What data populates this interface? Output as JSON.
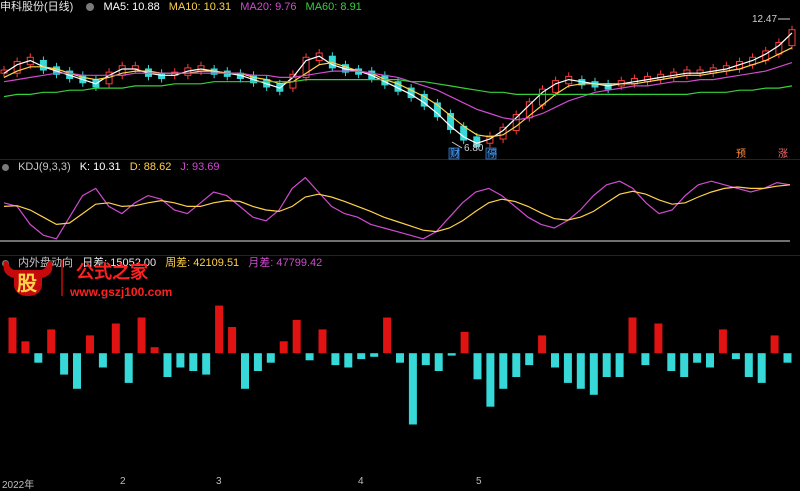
{
  "main": {
    "title": "申科股份(日线)",
    "ma": [
      {
        "label": "MA5: 10.88",
        "color": "#ffffff"
      },
      {
        "label": "MA10: 10.31",
        "color": "#ffd24a"
      },
      {
        "label": "MA20: 9.76",
        "color": "#d04bd0"
      },
      {
        "label": "MA60: 8.91",
        "color": "#35d13a"
      }
    ],
    "high_label": "12.47",
    "low_label": "6.80",
    "event_labels": [
      {
        "text": "财",
        "color": "#4aa3ff"
      },
      {
        "text": "停",
        "color": "#4aa3ff"
      },
      {
        "text": "预",
        "color": "#ff8c3a"
      },
      {
        "text": "涨",
        "color": "#ff6b6b"
      }
    ]
  },
  "kdj": {
    "title": "KDJ(9,3,3)",
    "k_label": "K: 10.31",
    "d_label": "D: 88.62",
    "j_label": "J: 93.69"
  },
  "flow": {
    "title": "内外盘动向",
    "day_label": "日差: 15052.00",
    "week_label": "周差: 42109.51",
    "month_label": "月差: 47799.42"
  },
  "axis": {
    "labels": [
      "2022年",
      "2",
      "3",
      "4",
      "5"
    ]
  },
  "watermark": {
    "logo_char": "股",
    "text": "公式之家",
    "url": "www.gszj100.com"
  },
  "chart_data": [
    {
      "type": "line",
      "name": "price",
      "series": [
        {
          "name": "MA5",
          "values": [
            10.4,
            10.8,
            11.0,
            10.7,
            10.5,
            10.3,
            10.1,
            9.9,
            10.3,
            10.6,
            10.6,
            10.4,
            10.3,
            10.3,
            10.5,
            10.6,
            10.5,
            10.4,
            10.3,
            10.1,
            9.9,
            9.7,
            10.2,
            11.0,
            11.2,
            10.8,
            10.6,
            10.5,
            10.3,
            10.0,
            9.7,
            9.4,
            9.0,
            8.5,
            7.9,
            7.4,
            7.1,
            7.3,
            7.7,
            8.3,
            8.9,
            9.5,
            9.9,
            10.1,
            10.0,
            9.9,
            9.8,
            9.9,
            10.0,
            10.1,
            10.2,
            10.3,
            10.4,
            10.4,
            10.5,
            10.6,
            10.8,
            11.0,
            11.3,
            11.7,
            12.3
          ]
        },
        {
          "name": "MA10",
          "values": [
            10.2,
            10.5,
            10.7,
            10.7,
            10.6,
            10.4,
            10.2,
            10.1,
            10.2,
            10.4,
            10.5,
            10.5,
            10.4,
            10.4,
            10.4,
            10.5,
            10.5,
            10.4,
            10.4,
            10.2,
            10.1,
            9.9,
            10.0,
            10.4,
            10.8,
            10.9,
            10.7,
            10.5,
            10.4,
            10.1,
            9.9,
            9.6,
            9.3,
            8.9,
            8.4,
            7.9,
            7.5,
            7.4,
            7.5,
            7.9,
            8.4,
            8.9,
            9.4,
            9.8,
            9.9,
            9.9,
            9.9,
            9.9,
            9.9,
            10.0,
            10.1,
            10.2,
            10.3,
            10.3,
            10.4,
            10.5,
            10.6,
            10.8,
            11.0,
            11.3,
            11.6
          ]
        },
        {
          "name": "MA20",
          "values": [
            10.0,
            10.1,
            10.2,
            10.3,
            10.4,
            10.4,
            10.3,
            10.3,
            10.3,
            10.3,
            10.4,
            10.4,
            10.4,
            10.4,
            10.4,
            10.4,
            10.4,
            10.4,
            10.4,
            10.3,
            10.3,
            10.2,
            10.2,
            10.3,
            10.4,
            10.5,
            10.5,
            10.5,
            10.4,
            10.3,
            10.2,
            10.0,
            9.8,
            9.6,
            9.3,
            9.0,
            8.7,
            8.5,
            8.3,
            8.2,
            8.3,
            8.5,
            8.8,
            9.1,
            9.3,
            9.5,
            9.6,
            9.7,
            9.8,
            9.8,
            9.9,
            10.0,
            10.0,
            10.1,
            10.1,
            10.2,
            10.3,
            10.4,
            10.5,
            10.7,
            10.9
          ]
        },
        {
          "name": "MA60",
          "values": [
            9.3,
            9.4,
            9.4,
            9.5,
            9.5,
            9.6,
            9.6,
            9.7,
            9.7,
            9.7,
            9.8,
            9.8,
            9.8,
            9.9,
            9.9,
            9.9,
            10.0,
            10.0,
            10.0,
            10.0,
            10.0,
            10.0,
            10.0,
            10.1,
            10.1,
            10.1,
            10.1,
            10.1,
            10.1,
            10.1,
            10.1,
            10.0,
            10.0,
            9.9,
            9.8,
            9.7,
            9.6,
            9.5,
            9.5,
            9.4,
            9.4,
            9.4,
            9.4,
            9.4,
            9.4,
            9.4,
            9.4,
            9.4,
            9.4,
            9.4,
            9.4,
            9.4,
            9.4,
            9.5,
            9.5,
            9.5,
            9.6,
            9.6,
            9.7,
            9.7,
            9.8
          ]
        }
      ],
      "ylim": [
        6.5,
        13.0
      ]
    },
    {
      "type": "line",
      "name": "kdj",
      "series": [
        {
          "name": "K",
          "values": [
            60,
            55,
            30,
            15,
            10,
            40,
            70,
            80,
            55,
            45,
            60,
            70,
            65,
            50,
            45,
            60,
            75,
            70,
            55,
            40,
            35,
            50,
            80,
            95,
            75,
            55,
            45,
            40,
            30,
            25,
            20,
            15,
            10,
            20,
            40,
            60,
            75,
            80,
            70,
            55,
            40,
            30,
            25,
            35,
            50,
            70,
            85,
            90,
            80,
            60,
            45,
            50,
            70,
            85,
            90,
            85,
            80,
            75,
            80,
            88,
            85
          ]
        },
        {
          "name": "D",
          "values": [
            55,
            56,
            50,
            40,
            30,
            32,
            45,
            58,
            60,
            55,
            56,
            60,
            63,
            60,
            55,
            55,
            60,
            63,
            62,
            55,
            50,
            48,
            55,
            68,
            72,
            68,
            62,
            55,
            48,
            40,
            34,
            28,
            22,
            20,
            25,
            35,
            48,
            60,
            65,
            62,
            55,
            46,
            38,
            36,
            40,
            48,
            60,
            72,
            76,
            72,
            64,
            58,
            60,
            68,
            75,
            80,
            82,
            80,
            80,
            83,
            85
          ]
        }
      ],
      "ylim": [
        0,
        100
      ]
    },
    {
      "type": "bar",
      "name": "flow",
      "values": [
        30,
        10,
        -8,
        20,
        -18,
        -30,
        15,
        -12,
        25,
        -25,
        30,
        5,
        -20,
        -12,
        -15,
        -18,
        40,
        22,
        -30,
        -15,
        -8,
        10,
        28,
        -6,
        20,
        -10,
        -12,
        -5,
        -3,
        30,
        -8,
        -60,
        -10,
        -15,
        -2,
        18,
        -22,
        -45,
        -30,
        -20,
        -10,
        15,
        -12,
        -25,
        -30,
        -35,
        -20,
        -20,
        30,
        -10,
        25,
        -15,
        -20,
        -8,
        -12,
        20,
        -5,
        -20,
        -25,
        15,
        -8
      ],
      "ylim": [
        -100,
        70
      ]
    }
  ]
}
